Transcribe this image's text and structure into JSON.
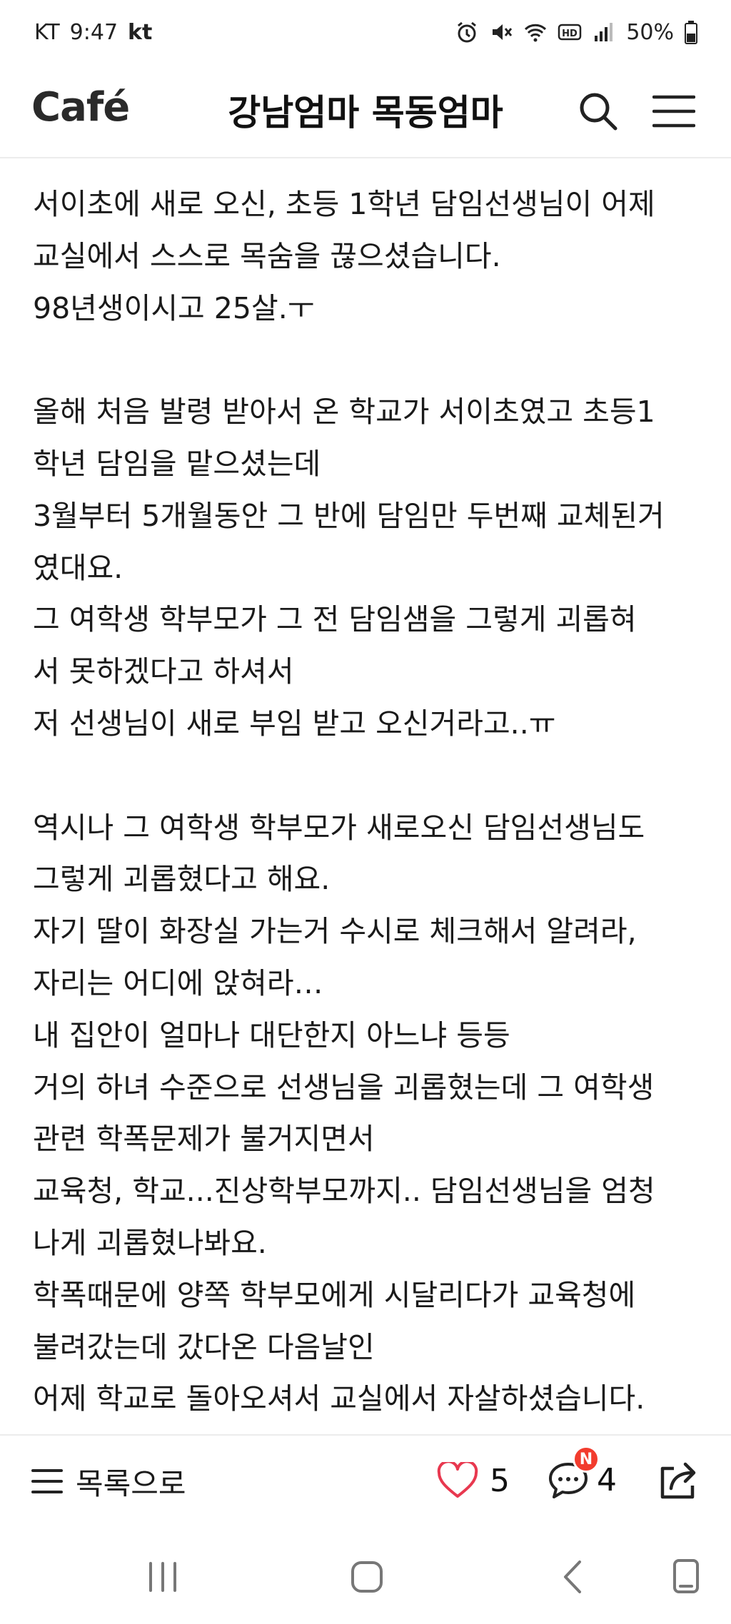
{
  "status": {
    "carrier": "KT",
    "time": "9:47",
    "carrier_logo": "kt",
    "battery": "50%",
    "icons": [
      "alarm-icon",
      "mute-icon",
      "wifi-icon",
      "hd-icon",
      "signal-icon",
      "battery-icon"
    ]
  },
  "header": {
    "logo": "Café",
    "title": "강남엄마 목동엄마",
    "icons": [
      "search-icon",
      "menu-icon"
    ]
  },
  "article": {
    "lines": [
      "서이초에 새로 오신, 초등 1학년 담임선생님이 어제",
      "교실에서 스스로 목숨을 끊으셨습니다.",
      "98년생이시고 25살.ㅜ",
      "",
      "올해 처음 발령 받아서 온 학교가 서이초였고 초등1",
      "학년 담임을 맡으셨는데",
      "3월부터 5개월동안 그 반에 담임만 두번째 교체된거",
      "였대요.",
      "그 여학생 학부모가 그 전 담임샘을 그렇게 괴롭혀",
      "서 못하겠다고 하셔서",
      "저 선생님이 새로 부임 받고 오신거라고..ㅠ",
      "",
      "역시나 그 여학생 학부모가 새로오신 담임선생님도",
      "그렇게 괴롭혔다고 해요.",
      "자기 딸이 화장실 가는거 수시로 체크해서 알려라,",
      "자리는 어디에 앉혀라…",
      "내 집안이 얼마나 대단한지 아느냐 등등",
      "거의 하녀 수준으로 선생님을 괴롭혔는데 그 여학생",
      "관련 학폭문제가 불거지면서",
      "교육청, 학교...진상학부모까지.. 담임선생님을 엄청",
      "나게 괴롭혔나봐요.",
      "학폭때문에 양쪽 학부모에게 시달리다가 교육청에",
      "불려갔는데 갔다온 다음날인",
      "어제 학교로 돌아오셔서 교실에서 자살하셨습니다."
    ]
  },
  "bottom_bar": {
    "list_label": "목록으로",
    "like_count": "5",
    "comment_count": "4",
    "new_badge": "N",
    "accent_like": "#e8384f",
    "badge_color": "#f23c2e"
  },
  "navbar": {
    "icons": [
      "recent-apps-icon",
      "home-icon",
      "back-icon",
      "keyboard-hide-icon"
    ]
  }
}
